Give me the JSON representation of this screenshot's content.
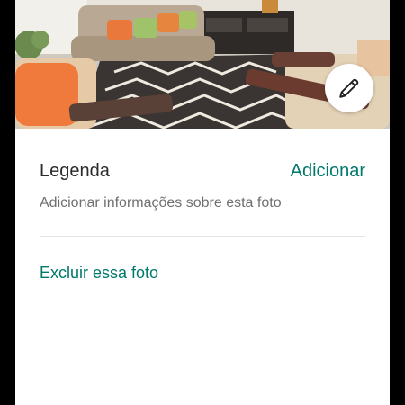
{
  "photo": {
    "icon": "edit-pencil-icon",
    "edit_icon": "pencil-icon"
  },
  "caption": {
    "label": "Legenda",
    "add_label": "Adicionar",
    "hint": "Adicionar informações sobre esta foto"
  },
  "actions": {
    "delete_label": "Excluir essa foto"
  },
  "colors": {
    "accent": "#00796b",
    "text_primary": "#2b2b2b",
    "text_secondary": "#6f6f6f",
    "divider": "#e3e3e3",
    "background": "#ffffff",
    "letterbox": "#000000"
  }
}
